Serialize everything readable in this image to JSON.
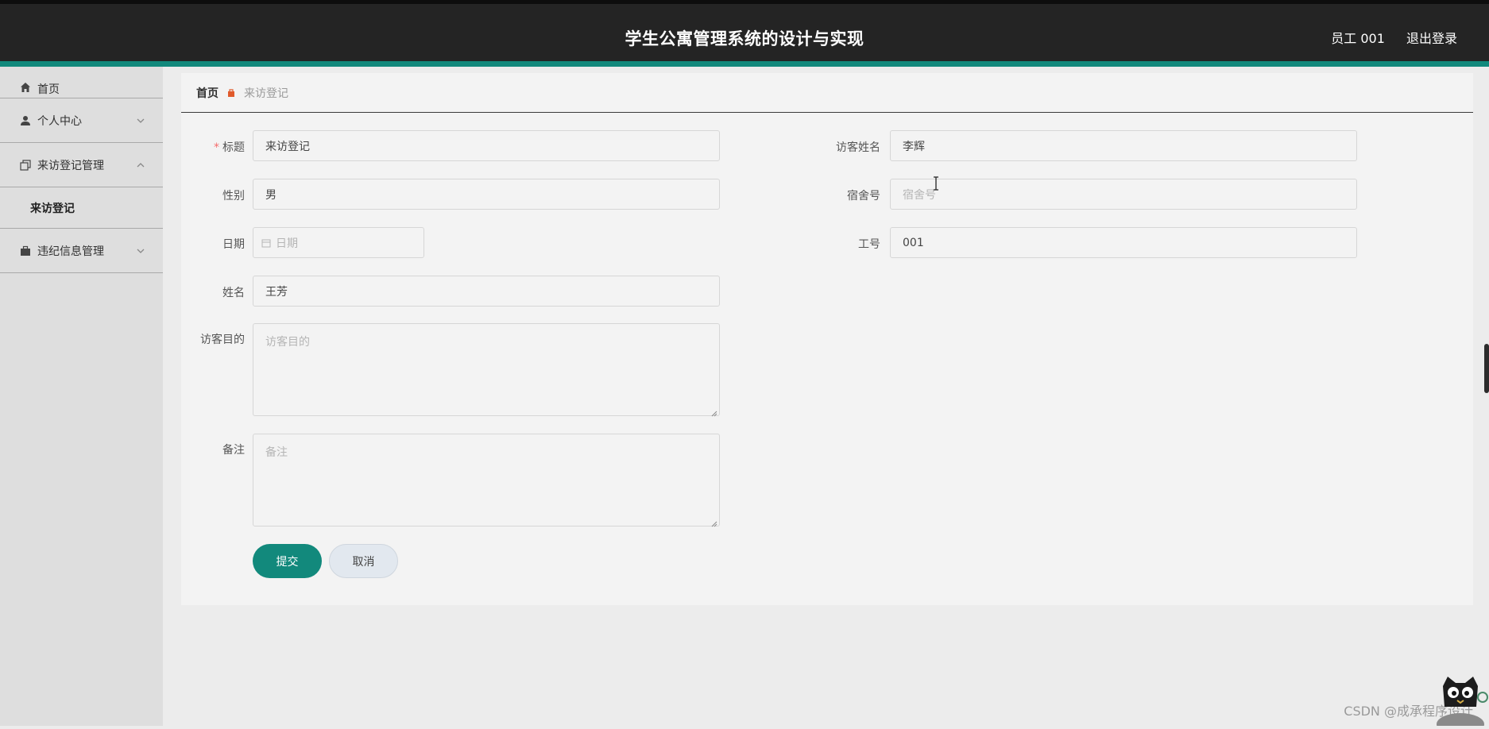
{
  "header": {
    "title": "学生公寓管理系统的设计与实现",
    "user": "员工 001",
    "logout": "退出登录"
  },
  "sidebar": {
    "items": [
      {
        "label": "首页",
        "icon": "home-icon"
      },
      {
        "label": "个人中心",
        "icon": "user-icon"
      },
      {
        "label": "来访登记管理",
        "icon": "copy-icon",
        "expanded": true,
        "children": [
          {
            "label": "来访登记"
          }
        ]
      },
      {
        "label": "违纪信息管理",
        "icon": "briefcase-icon"
      }
    ]
  },
  "breadcrumb": {
    "home": "首页",
    "current": "来访登记"
  },
  "form": {
    "title": {
      "label": "标题",
      "required_mark": "*",
      "value": "来访登记"
    },
    "visitor_name": {
      "label": "访客姓名",
      "value": "李辉"
    },
    "gender": {
      "label": "性别",
      "value": "男"
    },
    "dorm_no": {
      "label": "宿舍号",
      "placeholder": "宿舍号"
    },
    "date": {
      "label": "日期",
      "placeholder": "日期"
    },
    "staff_no": {
      "label": "工号",
      "value": "001"
    },
    "name": {
      "label": "姓名",
      "value": "王芳"
    },
    "purpose": {
      "label": "访客目的",
      "placeholder": "访客目的"
    },
    "remark": {
      "label": "备注",
      "placeholder": "备注"
    },
    "submit": "提交",
    "cancel": "取消"
  },
  "watermark": "CSDN @成承程序设计",
  "colors": {
    "accent": "#12897c",
    "header_bg": "#242424",
    "sidebar_bg": "#dedede"
  }
}
